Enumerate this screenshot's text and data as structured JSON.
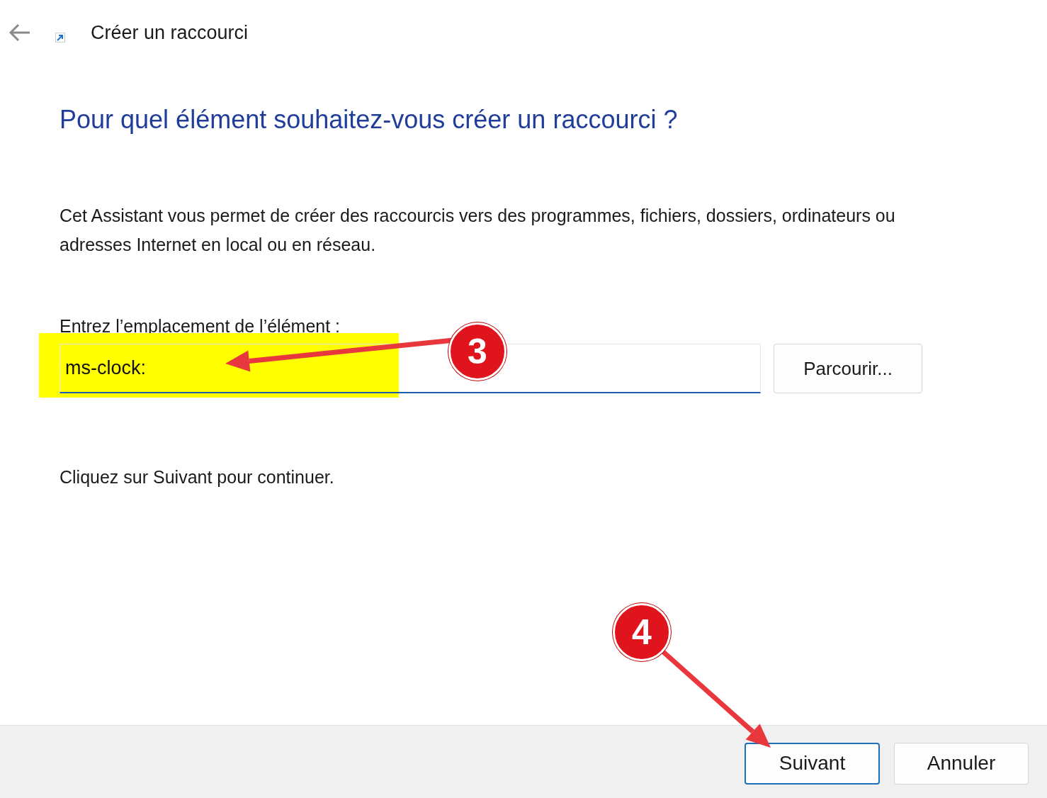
{
  "window": {
    "title": "Créer un raccourci"
  },
  "heading": "Pour quel élément souhaitez-vous créer un raccourci ?",
  "description": "Cet Assistant vous permet de créer des raccourcis vers des programmes, fichiers, dossiers, ordinateurs ou adresses Internet en local ou en réseau.",
  "location": {
    "label": "Entrez l’emplacement de l’élément :",
    "value": "ms-clock:",
    "highlighted": true
  },
  "browse_button": "Parcourir...",
  "hint": "Cliquez sur Suivant pour continuer.",
  "buttons": [
    {
      "label": "Suivant",
      "default": true
    },
    {
      "label": "Annuler",
      "default": false
    }
  ],
  "annotations": [
    {
      "number": "3"
    },
    {
      "number": "4"
    }
  ]
}
